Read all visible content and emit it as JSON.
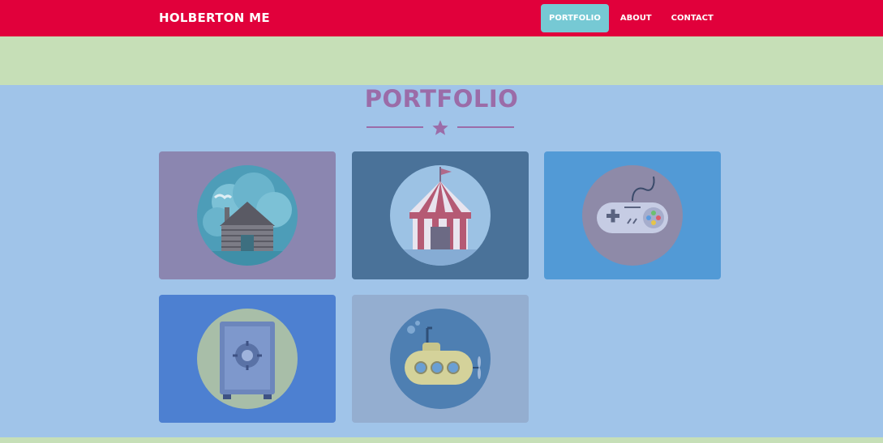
{
  "navbar": {
    "brand": "HOLBERTON ME",
    "links": [
      {
        "label": "PORTFOLIO",
        "active": true
      },
      {
        "label": "ABOUT",
        "active": false
      },
      {
        "label": "CONTACT",
        "active": false
      }
    ]
  },
  "portfolio": {
    "title": "PORTFOLIO",
    "divider_icon": "star-icon",
    "items": [
      {
        "icon": "cabin-icon",
        "background": "#8b86b0"
      },
      {
        "icon": "circus-tent-icon",
        "background": "#4a7299"
      },
      {
        "icon": "game-controller-icon",
        "background": "#529ad6"
      },
      {
        "icon": "safe-icon",
        "background": "#4d80d1"
      },
      {
        "icon": "submarine-icon",
        "background": "#94aed0"
      }
    ]
  },
  "colors": {
    "navbar": "#e1003b",
    "active_link": "#76c9d4",
    "accent_purple": "#9b6ca8",
    "section_bg": "#a0c4e9",
    "band_green": "#c6dfb7"
  }
}
